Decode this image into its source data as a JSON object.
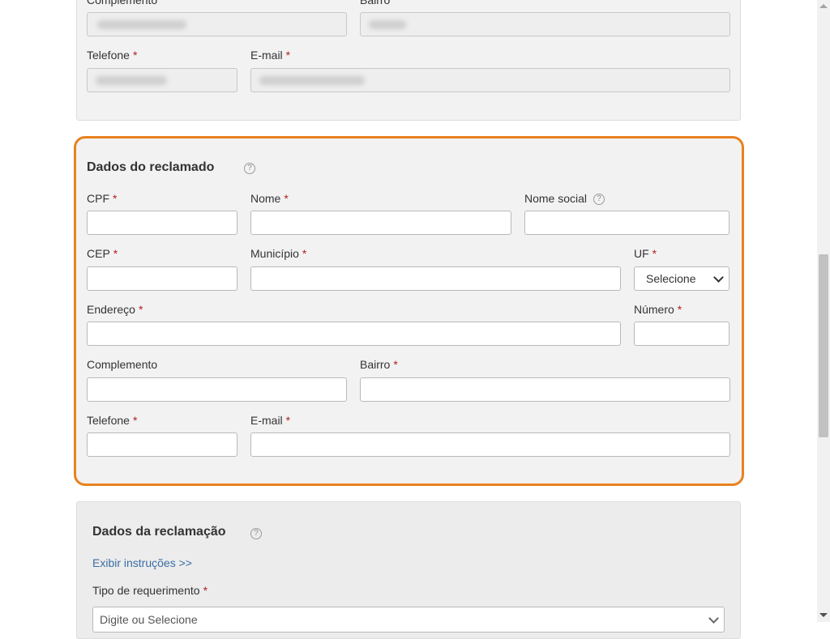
{
  "required_marker": "*",
  "help_glyph": "?",
  "complainant": {
    "complemento_label": "Complemento",
    "bairro_label": "Bairro",
    "telefone_label": "Telefone",
    "email_label": "E-mail"
  },
  "respondent": {
    "title": "Dados do reclamado",
    "cpf_label": "CPF",
    "nome_label": "Nome",
    "nome_social_label": "Nome social",
    "cep_label": "CEP",
    "municipio_label": "Município",
    "uf_label": "UF",
    "uf_selected": "Selecione",
    "endereco_label": "Endereço",
    "numero_label": "Número",
    "complemento_label": "Complemento",
    "bairro_label": "Bairro",
    "telefone_label": "Telefone",
    "email_label": "E-mail",
    "highlight_color": "#e8821e"
  },
  "complaint": {
    "title": "Dados da reclamação",
    "instructions_link": "Exibir instruções >>",
    "tipo_label": "Tipo de requerimento",
    "tipo_placeholder": "Digite ou Selecione"
  },
  "colors": {
    "required": "#b22222",
    "link": "#3a6ea5",
    "panel_bg": "#f2f2f2"
  }
}
